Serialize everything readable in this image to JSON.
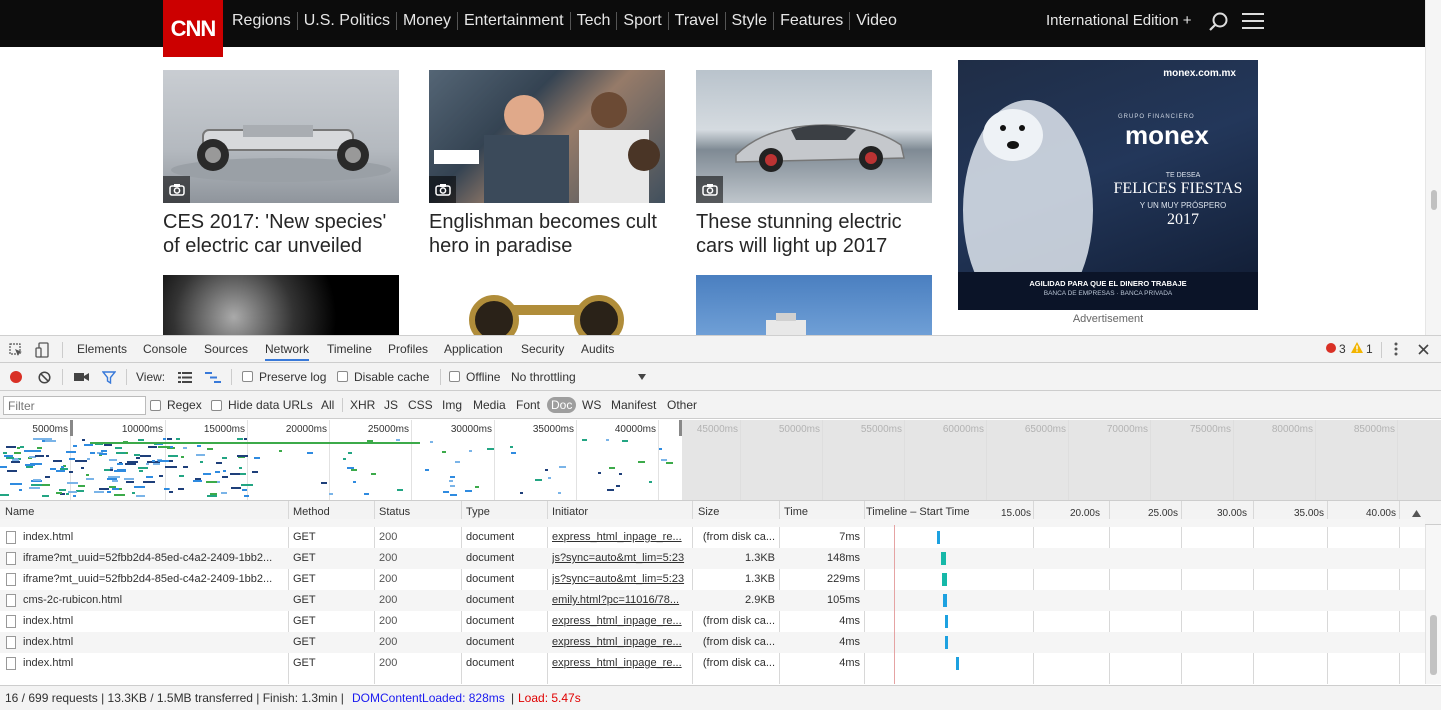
{
  "site": {
    "logo": "CNN",
    "nav": [
      "Regions",
      "U.S. Politics",
      "Money",
      "Entertainment",
      "Tech",
      "Sport",
      "Travel",
      "Style",
      "Features",
      "Video"
    ],
    "edition": "International Edition +",
    "cards": [
      {
        "headline": "CES 2017: 'New species' of electric car unveiled",
        "icon": "camera-icon"
      },
      {
        "headline": "Englishman becomes cult hero in paradise",
        "icon": "camera-icon"
      },
      {
        "headline": "These stunning electric cars will light up 2017",
        "icon": "camera-icon"
      }
    ],
    "ad": {
      "url": "monex.com.mx",
      "group": "GRUPO FINANCIERO",
      "brand": "monex",
      "line1": "TE DESEA",
      "line2": "FELICES FIESTAS",
      "line3": "Y UN MUY PRÓSPERO",
      "year": "2017",
      "tagline": "AGILIDAD PARA QUE EL DINERO TRABAJE",
      "subline": "BANCA DE EMPRESAS · BANCA PRIVADA",
      "caption": "Advertisement"
    }
  },
  "devtools": {
    "tabs": [
      "Elements",
      "Console",
      "Sources",
      "Network",
      "Timeline",
      "Profiles",
      "Application",
      "Security",
      "Audits"
    ],
    "active_tab": "Network",
    "errors": "3",
    "warnings": "1",
    "controls": {
      "view_label": "View:",
      "preserve_log": "Preserve log",
      "disable_cache": "Disable cache",
      "offline": "Offline",
      "throttling": "No throttling"
    },
    "filter": {
      "placeholder": "Filter",
      "regex": "Regex",
      "hide_data_urls": "Hide data URLs",
      "types": [
        "All",
        "XHR",
        "JS",
        "CSS",
        "Img",
        "Media",
        "Font",
        "Doc",
        "WS",
        "Manifest",
        "Other"
      ],
      "selected_type": "Doc"
    },
    "overview_ticks": [
      "5000ms",
      "10000ms",
      "15000ms",
      "20000ms",
      "25000ms",
      "30000ms",
      "35000ms",
      "40000ms",
      "45000ms",
      "50000ms",
      "55000ms",
      "60000ms",
      "65000ms",
      "70000ms",
      "75000ms",
      "80000ms",
      "85000ms"
    ],
    "columns": {
      "name": "Name",
      "method": "Method",
      "status": "Status",
      "type": "Type",
      "initiator": "Initiator",
      "size": "Size",
      "time": "Time",
      "timeline": "Timeline – Start Time"
    },
    "timeline_ticks": [
      "15.00s",
      "20.00s",
      "25.00s",
      "30.00s",
      "35.00s",
      "40.00s"
    ],
    "rows": [
      {
        "name": "index.html",
        "method": "GET",
        "status": "200",
        "type": "document",
        "initiator": "express_html_inpage_re...",
        "size": "(from disk ca...",
        "time": "7ms"
      },
      {
        "name": "iframe?mt_uuid=52fbb2d4-85ed-c4a2-2409-1bb2...",
        "method": "GET",
        "status": "200",
        "type": "document",
        "initiator": "js?sync=auto&mt_lim=5:23",
        "size": "1.3KB",
        "time": "148ms"
      },
      {
        "name": "iframe?mt_uuid=52fbb2d4-85ed-c4a2-2409-1bb2...",
        "method": "GET",
        "status": "200",
        "type": "document",
        "initiator": "js?sync=auto&mt_lim=5:23",
        "size": "1.3KB",
        "time": "229ms"
      },
      {
        "name": "cms-2c-rubicon.html",
        "method": "GET",
        "status": "200",
        "type": "document",
        "initiator": "emily.html?pc=11016/78...",
        "size": "2.9KB",
        "time": "105ms"
      },
      {
        "name": "index.html",
        "method": "GET",
        "status": "200",
        "type": "document",
        "initiator": "express_html_inpage_re...",
        "size": "(from disk ca...",
        "time": "4ms"
      },
      {
        "name": "index.html",
        "method": "GET",
        "status": "200",
        "type": "document",
        "initiator": "express_html_inpage_re...",
        "size": "(from disk ca...",
        "time": "4ms"
      },
      {
        "name": "index.html",
        "method": "GET",
        "status": "200",
        "type": "document",
        "initiator": "express_html_inpage_re...",
        "size": "(from disk ca...",
        "time": "4ms"
      }
    ],
    "status": {
      "requests": "16 / 699 requests | 13.3KB / 1.5MB transferred | Finish: 1.3min |",
      "dom_content_loaded": "DOMContentLoaded: 828ms",
      "separator": "|",
      "load": "Load: 5.47s"
    },
    "colors": {
      "accent": "#3879d9",
      "record": "#d93025",
      "dcl": "#1a1aef",
      "load": "#e00000",
      "waterfall": "#1da1e0",
      "waterfall_wait": "#16b8a8"
    }
  }
}
